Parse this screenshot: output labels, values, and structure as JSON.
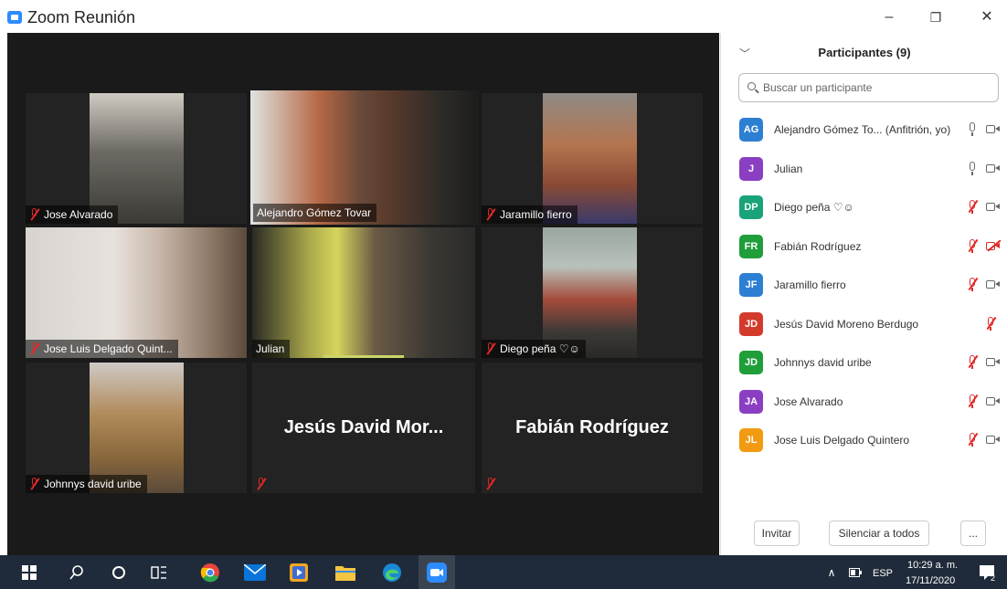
{
  "window": {
    "title": "Zoom Reunión",
    "minimize": "–",
    "restore": "❐",
    "close": "✕"
  },
  "accent_color": "#c9d66a",
  "tiles": [
    {
      "label": "Jose Alvarado",
      "muted": true
    },
    {
      "label": "Alejandro Gómez  Tovar",
      "muted": false,
      "active": true
    },
    {
      "label": "Jaramillo fierro",
      "muted": true
    },
    {
      "label": "Jose Luis Delgado Quint...",
      "muted": true
    },
    {
      "label": "Julian",
      "muted": false
    },
    {
      "label": "Diego peña ♡☺",
      "muted": true
    },
    {
      "label": "Johnnys david uribe",
      "muted": true
    },
    {
      "big_name": "Jesús David Mor...",
      "muted": true
    },
    {
      "big_name": "Fabián Rodríguez",
      "muted": true
    }
  ],
  "panel": {
    "title": "Participantes (9)",
    "search_placeholder": "Buscar un participante",
    "participants": [
      {
        "initials": "AG",
        "color": "#2d7fd3",
        "name": "Alejandro Gómez  To... (Anfitrión, yo)",
        "mic": "on",
        "cam": "on"
      },
      {
        "initials": "J",
        "color": "#8a3fc2",
        "name": "Julian",
        "mic": "on",
        "cam": "on"
      },
      {
        "initials": "DP",
        "color": "#1aa37a",
        "name": "Diego peña ♡☺",
        "mic": "off",
        "cam": "on"
      },
      {
        "initials": "FR",
        "color": "#1f9e3a",
        "name": "Fabián Rodríguez",
        "mic": "off",
        "cam": "off"
      },
      {
        "initials": "JF",
        "color": "#2d7fd3",
        "name": "Jaramillo fierro",
        "mic": "off",
        "cam": "on"
      },
      {
        "initials": "JD",
        "color": "#d33a2c",
        "name": "Jesús David Moreno Berdugo",
        "mic": "off",
        "cam": "none"
      },
      {
        "initials": "JD",
        "color": "#1f9e3a",
        "name": "Johnnys david uribe",
        "mic": "off",
        "cam": "on"
      },
      {
        "initials": "JA",
        "color": "#8a3fc2",
        "name": "Jose Alvarado",
        "mic": "off",
        "cam": "on"
      },
      {
        "initials": "JL",
        "color": "#f29a11",
        "name": "Jose Luis Delgado Quintero",
        "mic": "off",
        "cam": "on"
      }
    ],
    "invite_label": "Invitar",
    "mute_all_label": "Silenciar a todos",
    "more_label": "..."
  },
  "taskbar": {
    "lang": "ESP",
    "time": "10:29 a. m.",
    "date": "17/11/2020",
    "notif_count": "2"
  }
}
